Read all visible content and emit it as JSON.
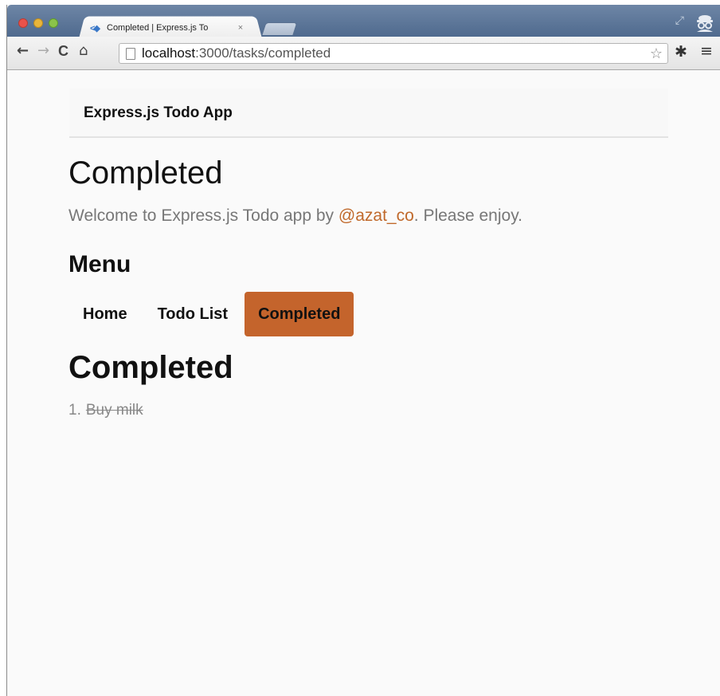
{
  "browser": {
    "tab": {
      "title": "Completed | Express.js To",
      "close": "×"
    },
    "address_bar": {
      "host": "localhost",
      "path": ":3000/tasks/completed"
    },
    "icons": {
      "back": "←",
      "forward": "→",
      "reload": "C",
      "home": "⌂",
      "star": "☆",
      "settings": "✱",
      "menu": "≡",
      "fullscreen": "⤢"
    }
  },
  "page": {
    "brand": "Express.js Todo App",
    "title": "Completed",
    "lead": {
      "prefix": "Welcome to Express.js Todo app by ",
      "handle": "@azat_co",
      "suffix": ". Please enjoy."
    },
    "menu_heading": "Menu",
    "menu": [
      {
        "label": "Home",
        "active": false
      },
      {
        "label": "Todo List",
        "active": false
      },
      {
        "label": "Completed",
        "active": true
      }
    ],
    "section_title": "Completed",
    "tasks": [
      {
        "number": "1.",
        "name": "Buy milk",
        "completed": true
      }
    ]
  },
  "colors": {
    "accent": "#c4642c",
    "link": "#c0692b",
    "muted_text": "#777777"
  }
}
